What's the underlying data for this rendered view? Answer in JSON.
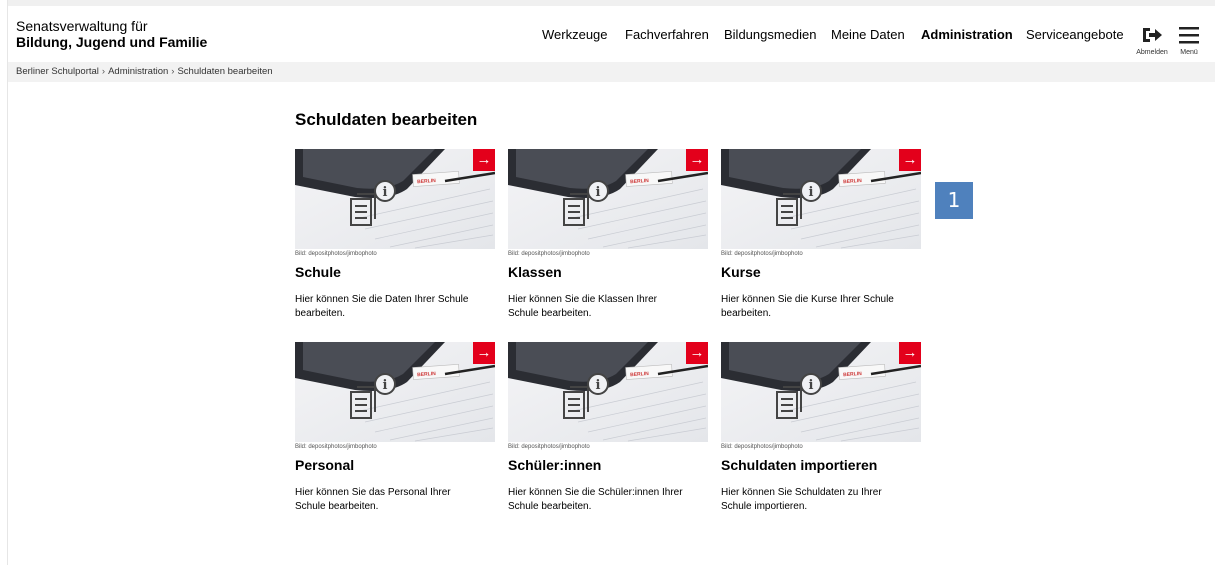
{
  "header": {
    "brand_line1": "Senatsverwaltung für",
    "brand_line2": "Bildung, Jugend und Familie",
    "nav": [
      "Werkzeuge",
      "Fachverfahren",
      "Bildungsmedien",
      "Meine Daten",
      "Administration",
      "Serviceangebote"
    ],
    "active_nav": "Administration",
    "logout_label": "Abmelden",
    "menu_label": "Menü",
    "icons": {
      "logout": "logout-icon",
      "menu": "hamburger-menu-icon"
    }
  },
  "breadcrumb": [
    "Berliner Schulportal",
    "Administration",
    "Schuldaten bearbeiten"
  ],
  "main": {
    "title": "Schuldaten bearbeiten",
    "cards": [
      {
        "credit": "Bild: depositphotos/jimbophoto",
        "title": "Schule",
        "desc": "Hier können Sie die Daten Ihrer Schule bearbeiten."
      },
      {
        "credit": "Bild: depositphotos/jimbophoto",
        "title": "Klassen",
        "desc": "Hier können Sie die Klassen Ihrer Schule bearbeiten."
      },
      {
        "credit": "Bild: depositphotos/jimbophoto",
        "title": "Kurse",
        "desc": "Hier können Sie die Kurse Ihrer Schule bearbeiten."
      },
      {
        "credit": "Bild: depositphotos/jimbophoto",
        "title": "Personal",
        "desc": "Hier können Sie das Personal Ihrer Schule bearbeiten."
      },
      {
        "credit": "Bild: depositphotos/jimbophoto",
        "title": "Schüler:innen",
        "desc": "Hier können Sie die Schüler:innen Ihrer Schule bearbeiten."
      },
      {
        "credit": "Bild: depositphotos/jimbophoto",
        "title": "Schuldaten importieren",
        "desc": "Hier können Sie Schuldaten zu Ihrer Schule importieren."
      }
    ],
    "card_image_text": "BERLIN",
    "arrow_glyph": "→"
  },
  "annotation_badge": "1",
  "colors": {
    "accent_red": "#e3001b",
    "badge_blue": "#4f81bd",
    "breadcrumb_bg": "#f2f2f2"
  }
}
